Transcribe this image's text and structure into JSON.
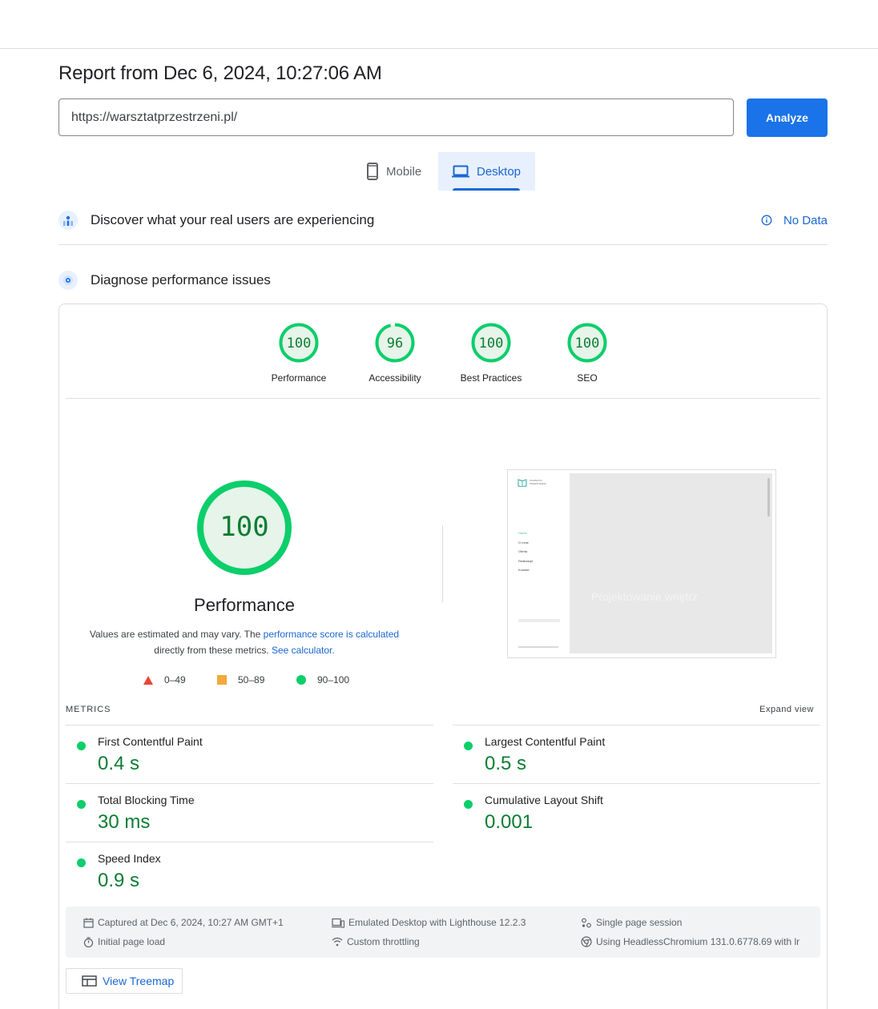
{
  "report": {
    "title": "Report from Dec 6, 2024, 10:27:06 AM",
    "url": "https://warsztatprzestrzeni.pl/",
    "analyze_label": "Analyze"
  },
  "tabs": [
    {
      "label": "Mobile",
      "icon": "phone-icon",
      "active": false
    },
    {
      "label": "Desktop",
      "icon": "laptop-icon",
      "active": true
    }
  ],
  "real_users": {
    "title": "Discover what your real users are experiencing",
    "status": "No Data"
  },
  "diagnose": {
    "title": "Diagnose performance issues"
  },
  "categories": [
    {
      "label": "Performance",
      "score": "100",
      "fraction": 1.0
    },
    {
      "label": "Accessibility",
      "score": "96",
      "fraction": 0.96
    },
    {
      "label": "Best Practices",
      "score": "100",
      "fraction": 1.0
    },
    {
      "label": "SEO",
      "score": "100",
      "fraction": 1.0
    }
  ],
  "performance": {
    "score": "100",
    "fraction": 1.0,
    "title": "Performance",
    "note_prefix": "Values are estimated and may vary. The ",
    "note_link1": "performance score is calculated",
    "note_middle": "directly from these metrics. ",
    "note_link2": "See calculator."
  },
  "legend": [
    {
      "range": "0–49",
      "shape": "triangle",
      "color": "#eb4335"
    },
    {
      "range": "50–89",
      "shape": "square",
      "color": "#f4a93a"
    },
    {
      "range": "90–100",
      "shape": "circle",
      "color": "#0cce6b"
    }
  ],
  "screenshot": {
    "brand": "WARSZTAT PRZESTRZENI",
    "nav": [
      "Home",
      "O mnie",
      "Oferta",
      "Realizacje",
      "Kontakt"
    ],
    "hero": "Projektowanie wnętrz"
  },
  "metrics": {
    "heading": "METRICS",
    "expand_label": "Expand view",
    "items": [
      {
        "name": "First Contentful Paint",
        "value": "0.4 s"
      },
      {
        "name": "Largest Contentful Paint",
        "value": "0.5 s"
      },
      {
        "name": "Total Blocking Time",
        "value": "30 ms"
      },
      {
        "name": "Cumulative Layout Shift",
        "value": "0.001"
      },
      {
        "name": "Speed Index",
        "value": "0.9 s"
      }
    ]
  },
  "run_info": {
    "captured": "Captured at Dec 6, 2024, 10:27 AM GMT+1",
    "load": "Initial page load",
    "emulated": "Emulated Desktop with Lighthouse 12.2.3",
    "throttling": "Custom throttling",
    "session": "Single page session",
    "browser": "Using HeadlessChromium 131.0.6778.69 with lr"
  },
  "treemap_label": "View Treemap",
  "colors": {
    "accent": "#1a73e8",
    "pass": "#0cce6b",
    "pass_text": "#0c7d32",
    "pass_fill": "#e6f4ea"
  }
}
